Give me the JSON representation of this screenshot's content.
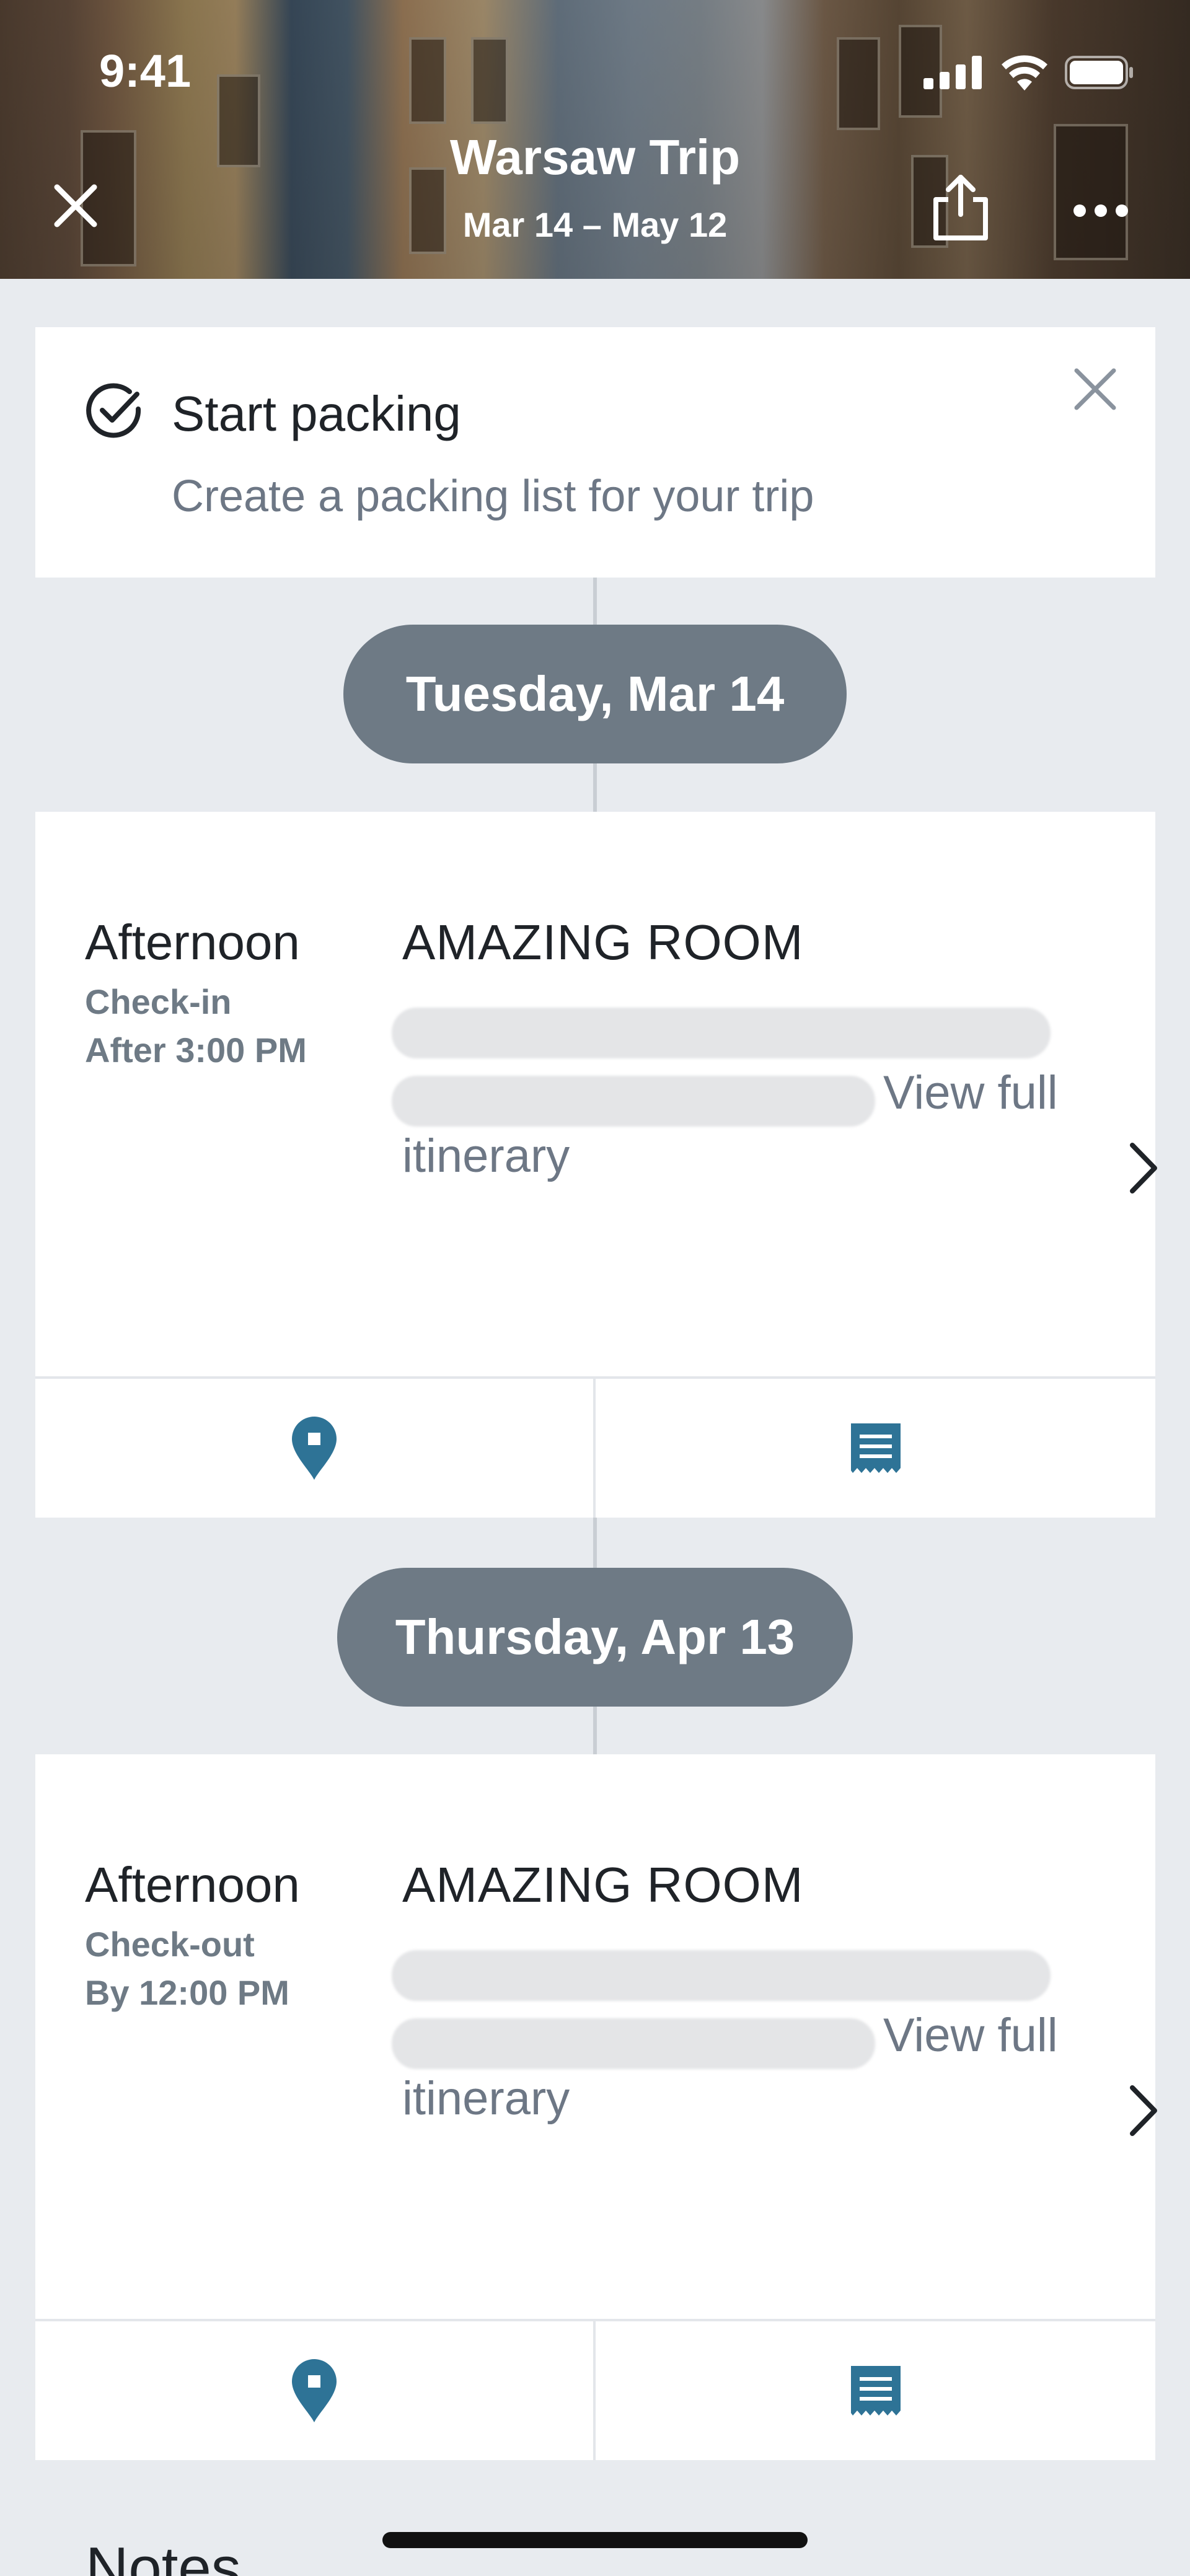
{
  "status_bar": {
    "time": "9:41"
  },
  "header": {
    "title": "Warsaw Trip",
    "dates": "Mar 14 – May 12"
  },
  "packing_card": {
    "title": "Start packing",
    "subtitle": "Create a packing list for your trip"
  },
  "days": [
    {
      "date": "Tuesday, Mar 14",
      "reservation": {
        "time_of_day": "Afternoon",
        "action": "Check-in",
        "time": "After 3:00 PM",
        "name": "AMAZING ROOM",
        "view_full": "View full",
        "itinerary": "itinerary"
      }
    },
    {
      "date": "Thursday, Apr 13",
      "reservation": {
        "time_of_day": "Afternoon",
        "action": "Check-out",
        "time": "By 12:00 PM",
        "name": "AMAZING ROOM",
        "view_full": "View full",
        "itinerary": "itinerary"
      }
    }
  ],
  "notes": {
    "title": "Notes"
  },
  "icons": {
    "accent": "#2e7396",
    "map": "map-pin-icon",
    "receipt": "receipt-icon"
  }
}
